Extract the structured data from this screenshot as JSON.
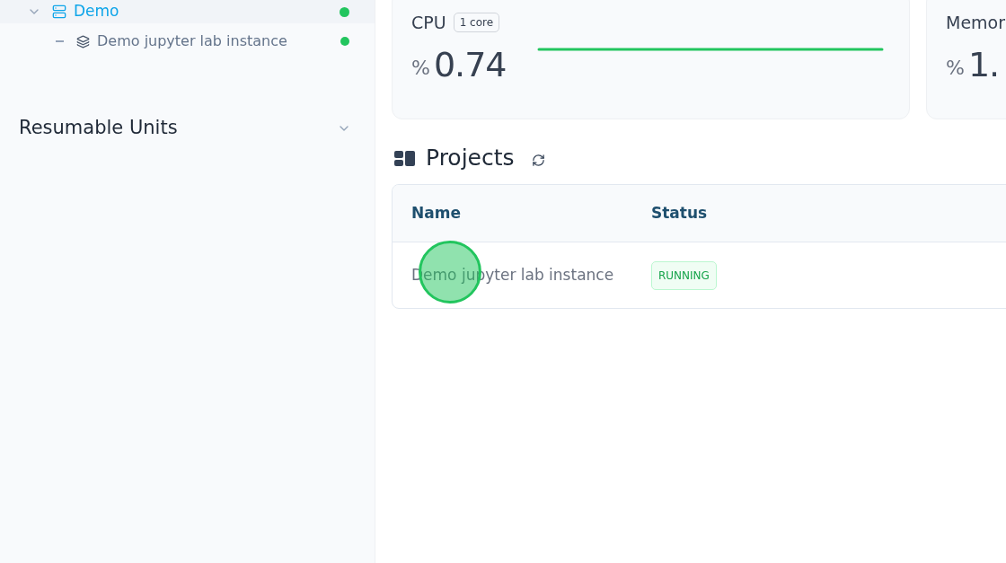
{
  "sidebar": {
    "tree": [
      {
        "label": "Demo",
        "color": "#22c55e",
        "selected": true,
        "children": [
          {
            "label": "Demo jupyter lab instance",
            "color": "#22c55e"
          }
        ]
      }
    ],
    "sections": [
      {
        "label": "Resumable Units",
        "expanded": false
      }
    ]
  },
  "metrics": [
    {
      "title": "CPU",
      "badge": "1 core",
      "unit": "%",
      "value": "0.74"
    },
    {
      "title": "Memor",
      "unit": "%",
      "value": "1."
    }
  ],
  "projects": {
    "title": "Projects",
    "columns": [
      "Name",
      "Status"
    ],
    "rows": [
      {
        "name": "Demo jupyter lab instance",
        "status": "RUNNING"
      }
    ]
  }
}
